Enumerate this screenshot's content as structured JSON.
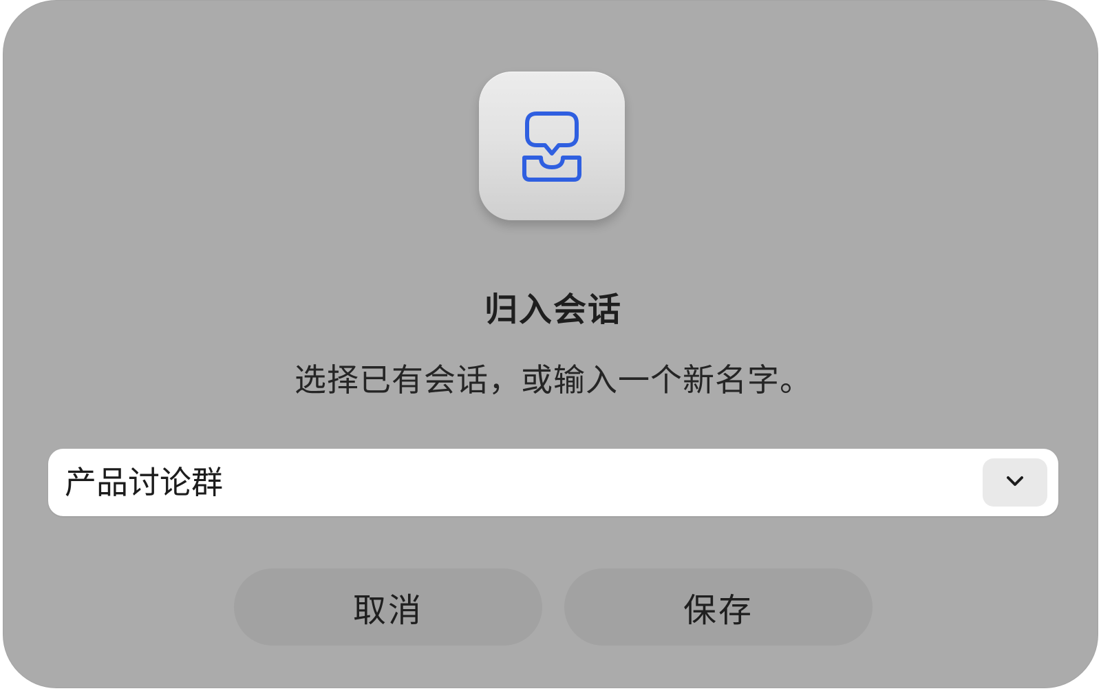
{
  "dialog": {
    "app_icon": "chat-inbox-icon",
    "icon_color": "#2f5fe0",
    "title": "归入会话",
    "message": "选择已有会话，或输入一个新名字。",
    "combo": {
      "value": "产品讨论群",
      "dropdown_icon": "chevron-down-icon"
    },
    "buttons": {
      "cancel_label": "取消",
      "save_label": "保存"
    }
  }
}
